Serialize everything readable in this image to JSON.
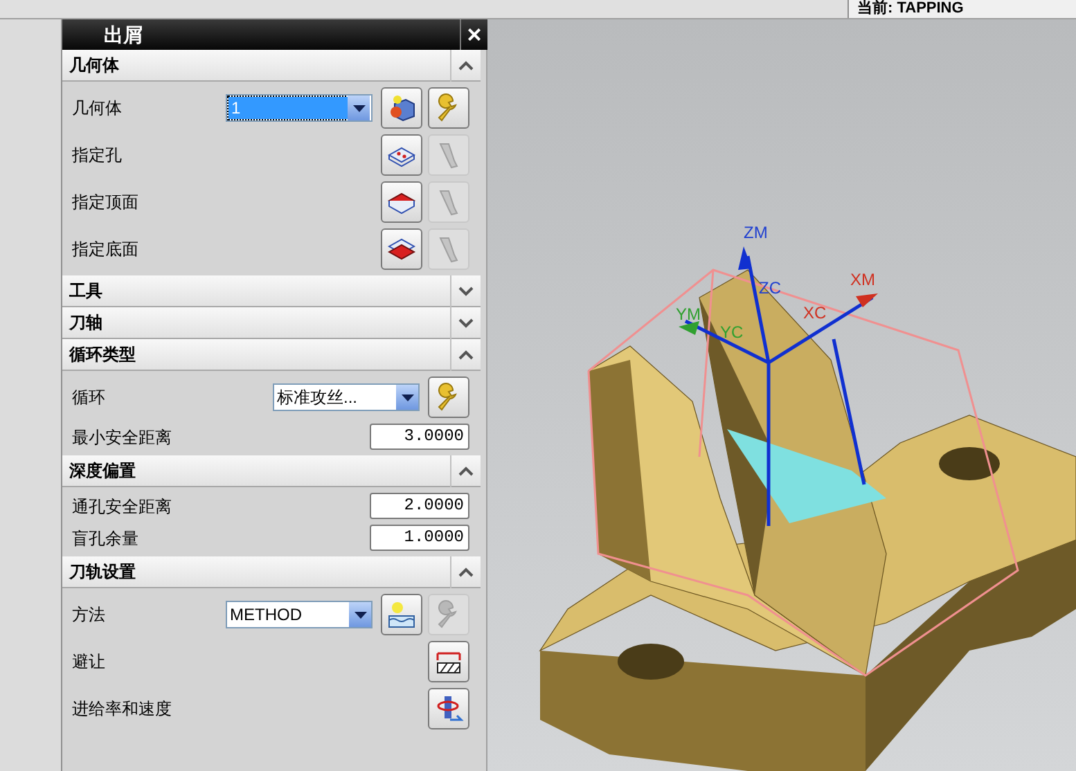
{
  "status": {
    "text": "当前: TAPPING"
  },
  "dialog": {
    "title": "出屑",
    "close": "×"
  },
  "sections": [
    {
      "title": "几何体",
      "expanded": true,
      "rows": [
        {
          "kind": "dropdown",
          "label": "几何体",
          "value": "1",
          "focused": true,
          "buttons": [
            {
              "disabled": false
            },
            {
              "disabled": false
            }
          ]
        },
        {
          "kind": "buttons",
          "label": "指定孔",
          "buttons": [
            {
              "disabled": false
            },
            {
              "disabled": true
            }
          ]
        },
        {
          "kind": "buttons",
          "label": "指定顶面",
          "buttons": [
            {
              "disabled": false
            },
            {
              "disabled": true
            }
          ]
        },
        {
          "kind": "buttons",
          "label": "指定底面",
          "buttons": [
            {
              "disabled": false
            },
            {
              "disabled": true
            }
          ]
        }
      ]
    },
    {
      "title": "工具",
      "expanded": false
    },
    {
      "title": "刀轴",
      "expanded": false
    },
    {
      "title": "循环类型",
      "expanded": true,
      "rows": [
        {
          "kind": "dropdown",
          "label": "循环",
          "value": "标准攻丝...",
          "focused": false,
          "buttons": [
            {
              "disabled": false
            }
          ]
        },
        {
          "kind": "number",
          "label": "最小安全距离",
          "value": "3.0000"
        }
      ]
    },
    {
      "title": "深度偏置",
      "expanded": true,
      "rows": [
        {
          "kind": "number",
          "label": "通孔安全距离",
          "value": "2.0000"
        },
        {
          "kind": "number",
          "label": "盲孔余量",
          "value": "1.0000"
        }
      ]
    },
    {
      "title": "刀轨设置",
      "expanded": true,
      "rows": [
        {
          "kind": "dropdown",
          "label": "方法",
          "value": "METHOD",
          "focused": false,
          "buttons": [
            {
              "disabled": false
            },
            {
              "disabled": true
            }
          ]
        },
        {
          "kind": "buttons",
          "label": "避让",
          "buttons": [
            {
              "disabled": false
            }
          ]
        },
        {
          "kind": "buttons",
          "label": "进给率和速度",
          "buttons": [
            {
              "disabled": false
            }
          ]
        }
      ]
    }
  ],
  "viewport": {
    "axes": [
      "ZM",
      "ZC",
      "XM",
      "XC",
      "YM",
      "YC"
    ]
  }
}
